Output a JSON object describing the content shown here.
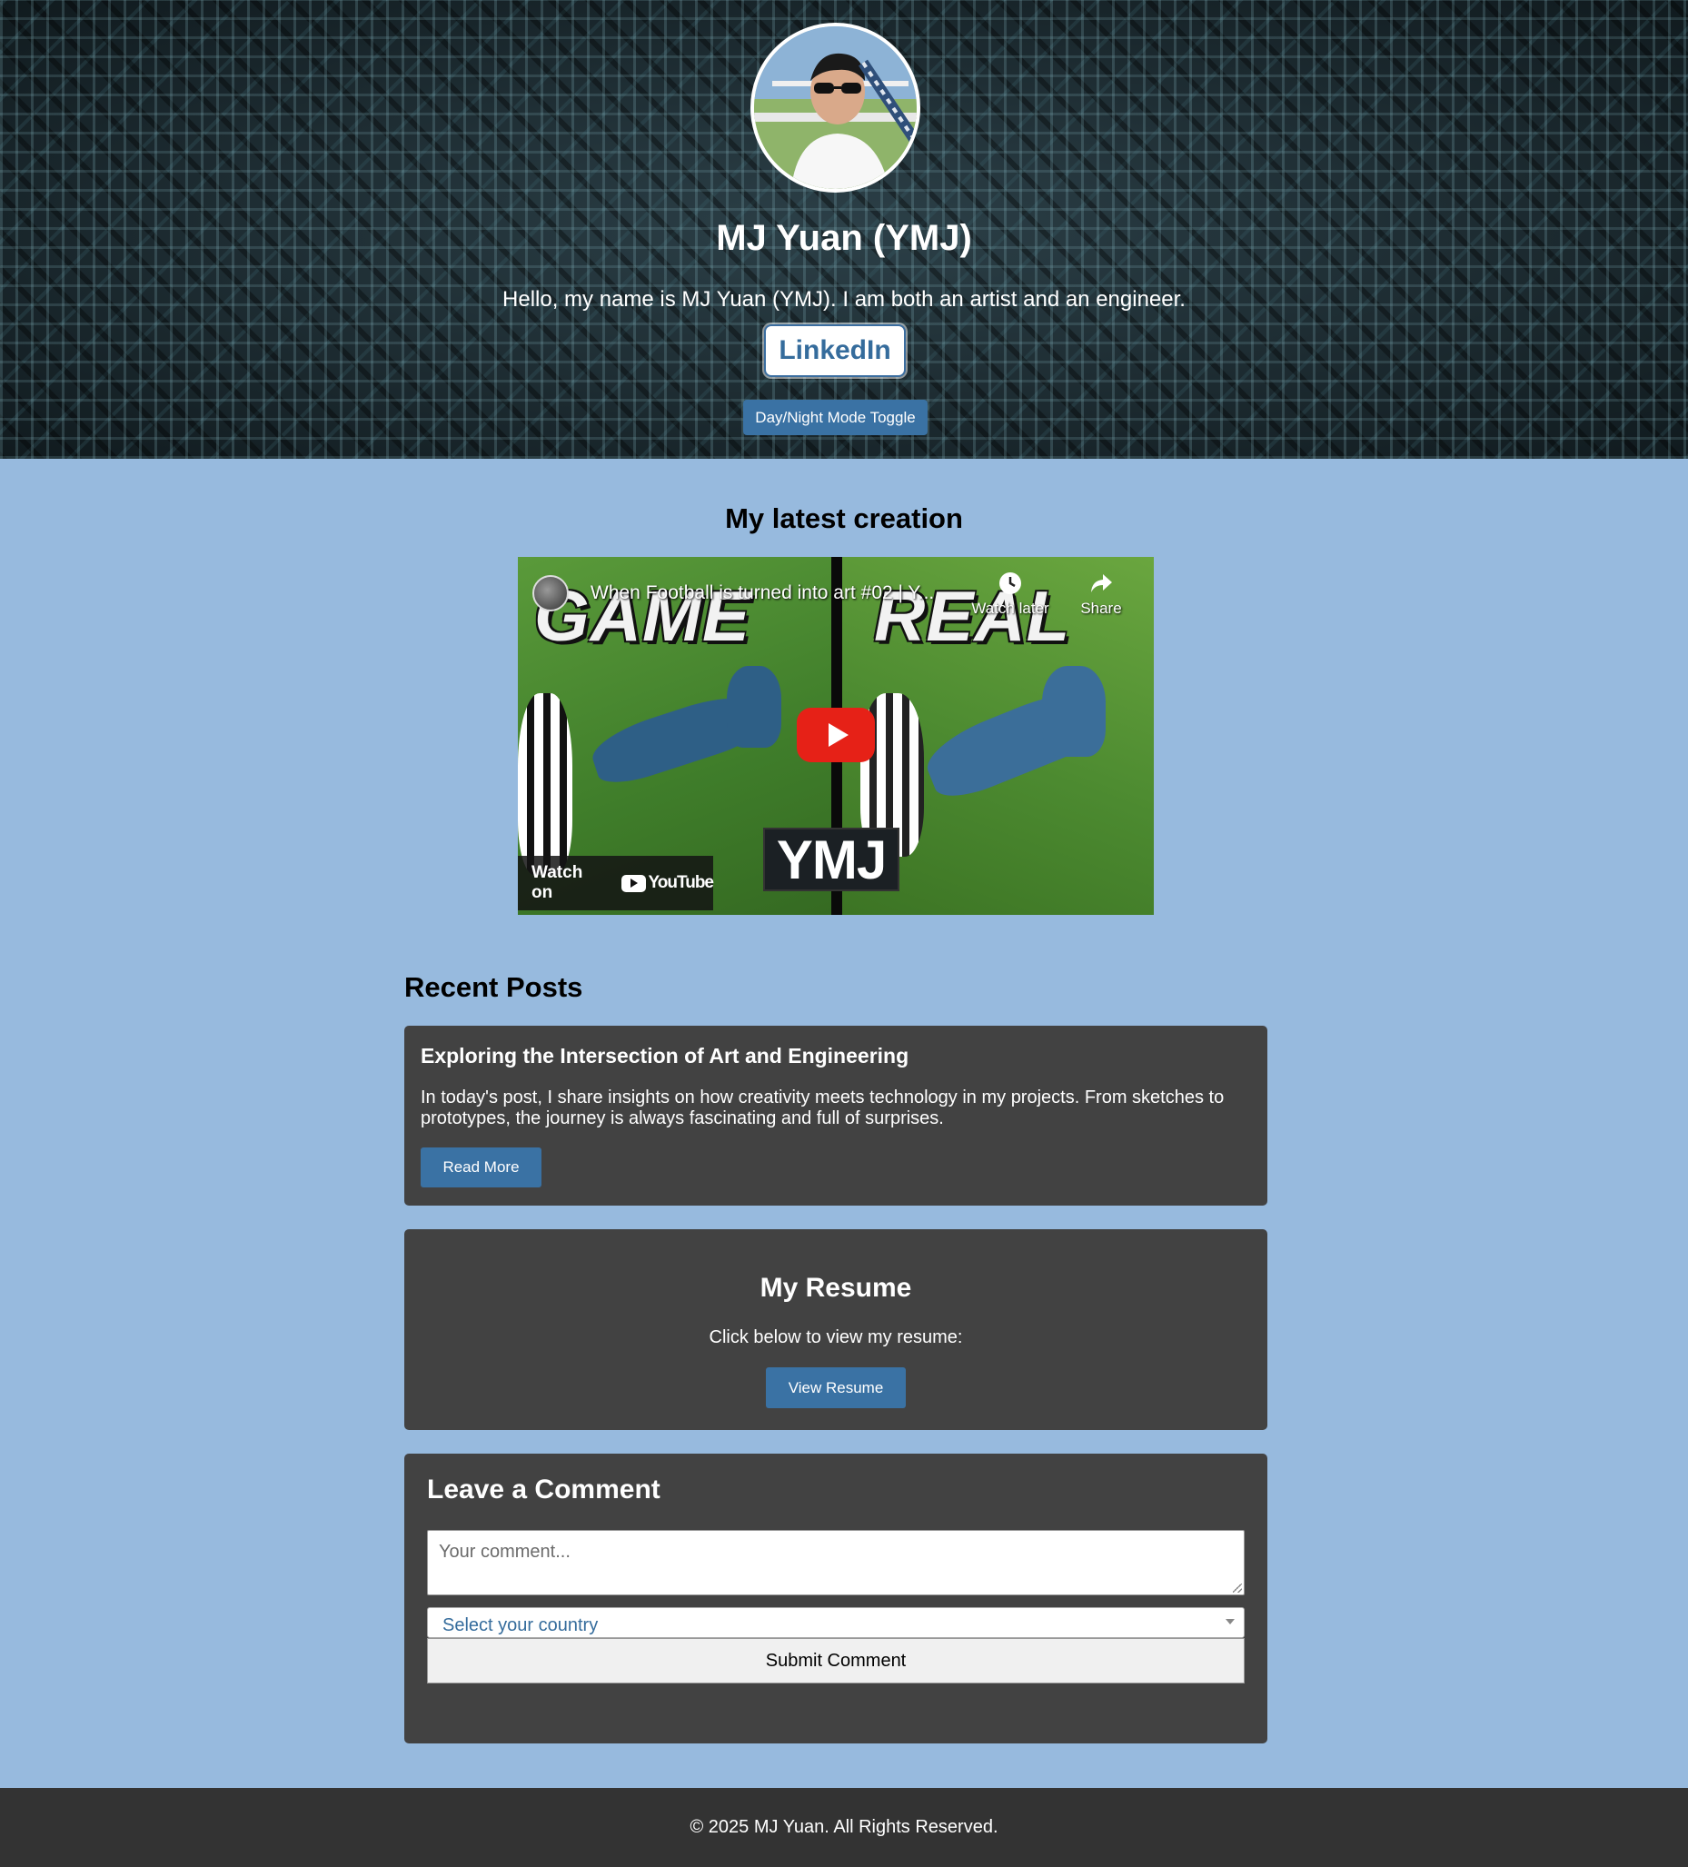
{
  "header": {
    "name": "MJ Yuan (YMJ)",
    "intro": "Hello, my name is MJ Yuan (YMJ). I am both an artist and an engineer.",
    "linkedin_label": "LinkedIn",
    "toggle_label": "Day/Night Mode Toggle"
  },
  "latest": {
    "heading": "My latest creation",
    "video": {
      "title": "When Football is turned into art #02 | Y...",
      "watch_later_label": "Watch later",
      "share_label": "Share",
      "left_word": "GAME",
      "right_word": "REAL",
      "badge": "YMJ",
      "watch_on_label": "Watch on",
      "youtube_label": "YouTube"
    }
  },
  "posts": {
    "heading": "Recent Posts",
    "items": [
      {
        "title": "Exploring the Intersection of Art and Engineering",
        "body": "In today's post, I share insights on how creativity meets technology in my projects. From sketches to prototypes, the journey is always fascinating and full of surprises.",
        "button": "Read More"
      }
    ]
  },
  "resume": {
    "title": "My Resume",
    "text": "Click below to view my resume:",
    "button": "View Resume"
  },
  "comment": {
    "title": "Leave a Comment",
    "placeholder": "Your comment...",
    "country_selected": "Select your country",
    "submit_label": "Submit Comment"
  },
  "footer": {
    "text": "© 2025 MJ Yuan. All Rights Reserved."
  },
  "colors": {
    "page_bg": "#97bade",
    "card_bg": "#424242",
    "accent_blue": "#3a72a4",
    "footer_bg": "#333333",
    "youtube_red": "#e62117"
  },
  "icons": [
    "profile-avatar",
    "channel-icon",
    "clock-icon",
    "share-icon",
    "play-icon",
    "youtube-logo-icon",
    "chevron-down-icon",
    "resize-grip-icon"
  ]
}
